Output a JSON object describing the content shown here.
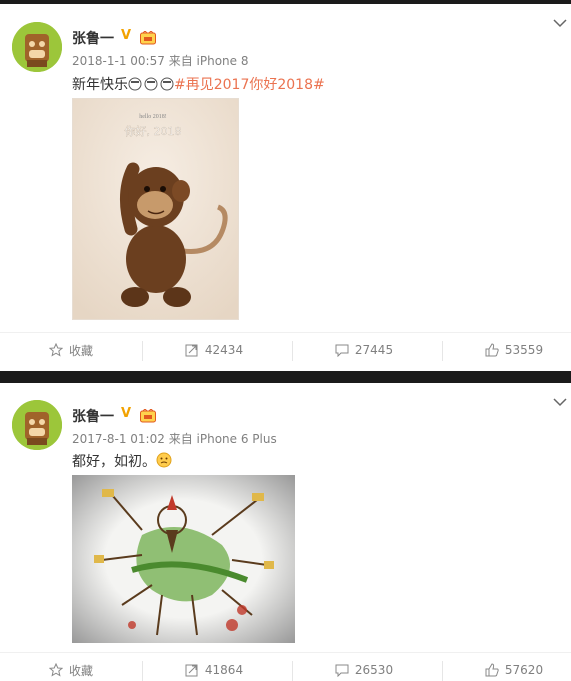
{
  "posts": [
    {
      "author": "张鲁一",
      "verified_mark": "V",
      "time": "2018-1-1 00:57",
      "source": "来自 iPhone 8",
      "text": "新年快乐",
      "hashtag": "#再见2017你好2018#",
      "image_caption_handwriting": "你好, 2018",
      "image_caption_small": "hello 2018!",
      "actions": {
        "favorite": "收藏",
        "reposts": "42434",
        "comments": "27445",
        "likes": "53559"
      }
    },
    {
      "author": "张鲁一",
      "verified_mark": "V",
      "time": "2017-8-1 01:02",
      "source": "来自 iPhone 6 Plus",
      "text": "都好，如初。",
      "actions": {
        "favorite": "收藏",
        "reposts": "41864",
        "comments": "26530",
        "likes": "57620"
      }
    }
  ],
  "colors": {
    "link": "#eb7350",
    "meta": "#808080",
    "badge": "#f2a200",
    "avatar": "#9cc63a"
  },
  "icons": [
    "avatar-monkey-icon",
    "vip-badge-icon",
    "more-chevron-icon",
    "star-icon",
    "repost-icon",
    "comment-icon",
    "thumb-up-icon"
  ]
}
